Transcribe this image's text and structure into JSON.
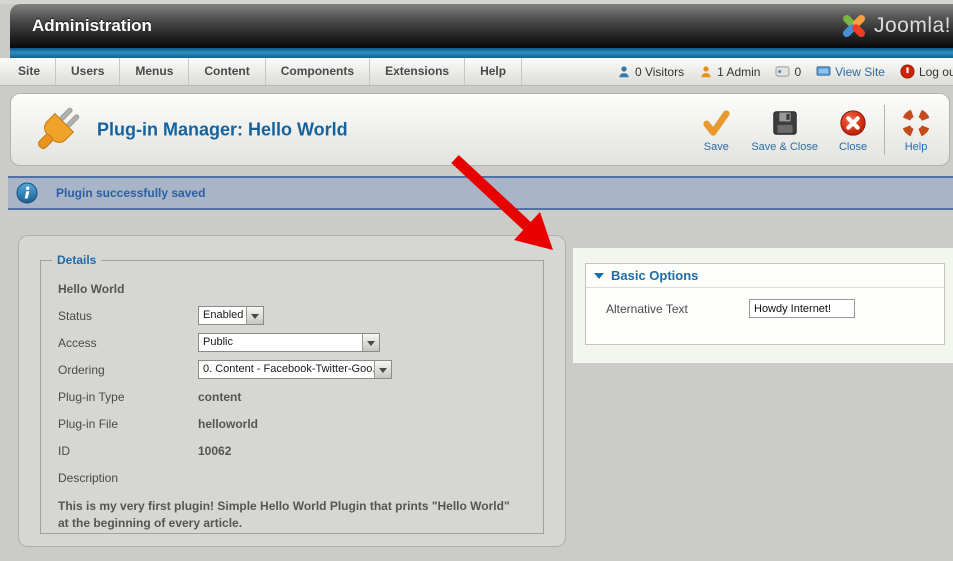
{
  "header": {
    "title": "Administration",
    "logo_text": "Joomla!"
  },
  "menu": {
    "items": [
      "Site",
      "Users",
      "Menus",
      "Content",
      "Components",
      "Extensions",
      "Help"
    ]
  },
  "statusbar": {
    "visitors": "0 Visitors",
    "admin": "1 Admin",
    "messages": "0",
    "view_site": "View Site",
    "log_out": "Log out"
  },
  "toolbar": {
    "title": "Plug-in Manager: Hello World",
    "save": "Save",
    "save_close": "Save & Close",
    "close": "Close",
    "help": "Help"
  },
  "message": {
    "text": "Plugin successfully saved"
  },
  "details": {
    "legend": "Details",
    "plugin_name": "Hello World",
    "status_label": "Status",
    "status_value": "Enabled",
    "access_label": "Access",
    "access_value": "Public",
    "ordering_label": "Ordering",
    "ordering_value": "0. Content - Facebook-Twitter-Goo...",
    "type_label": "Plug-in Type",
    "type_value": "content",
    "file_label": "Plug-in File",
    "file_value": "helloworld",
    "id_label": "ID",
    "id_value": "10062",
    "description_label": "Description",
    "description_text": "This is my very first plugin! Simple Hello World Plugin that prints \"Hello World\" at the beginning of every article."
  },
  "basic_options": {
    "title": "Basic Options",
    "alt_text_label": "Alternative Text",
    "alt_text_value": "Howdy Internet!"
  },
  "colors": {
    "accent_blue": "#1c6cab",
    "message_bg": "#a8b4c8",
    "arrow_red": "#e80000"
  }
}
